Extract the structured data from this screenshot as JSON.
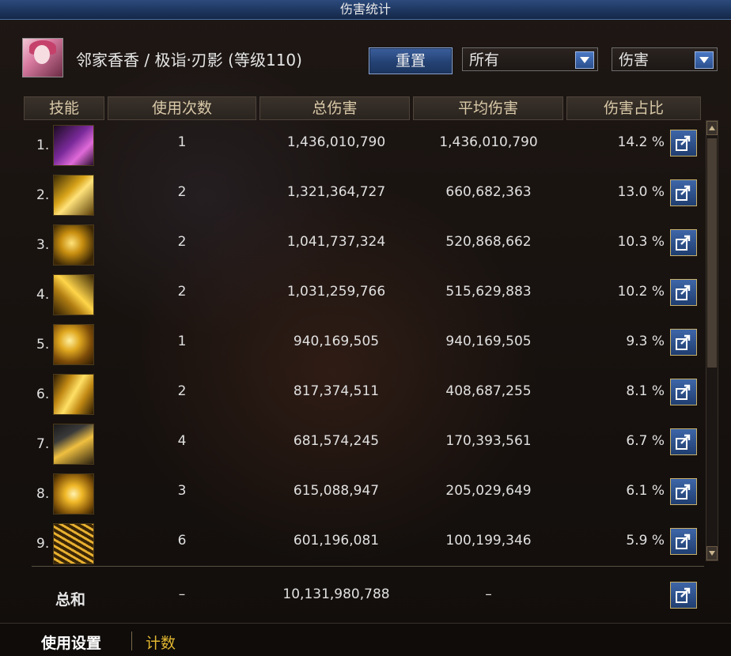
{
  "window": {
    "title": "伤害统计"
  },
  "character": {
    "name": "邻家香香 / 极诣·刃影 (等级110)"
  },
  "toolbar": {
    "reset_label": "重置",
    "filter_value": "所有",
    "metric_value": "伤害"
  },
  "table": {
    "headers": [
      "技能",
      "使用次数",
      "总伤害",
      "平均伤害",
      "伤害占比"
    ],
    "rows": [
      {
        "rank": "1.",
        "uses": "1",
        "total": "1,436,010,790",
        "avg": "1,436,010,790",
        "pct": "14.2 %"
      },
      {
        "rank": "2.",
        "uses": "2",
        "total": "1,321,364,727",
        "avg": "660,682,363",
        "pct": "13.0 %"
      },
      {
        "rank": "3.",
        "uses": "2",
        "total": "1,041,737,324",
        "avg": "520,868,662",
        "pct": "10.3 %"
      },
      {
        "rank": "4.",
        "uses": "2",
        "total": "1,031,259,766",
        "avg": "515,629,883",
        "pct": "10.2 %"
      },
      {
        "rank": "5.",
        "uses": "1",
        "total": "940,169,505",
        "avg": "940,169,505",
        "pct": "9.3 %"
      },
      {
        "rank": "6.",
        "uses": "2",
        "total": "817,374,511",
        "avg": "408,687,255",
        "pct": "8.1 %"
      },
      {
        "rank": "7.",
        "uses": "4",
        "total": "681,574,245",
        "avg": "170,393,561",
        "pct": "6.7 %"
      },
      {
        "rank": "8.",
        "uses": "3",
        "total": "615,088,947",
        "avg": "205,029,649",
        "pct": "6.1 %"
      },
      {
        "rank": "9.",
        "uses": "6",
        "total": "601,196,081",
        "avg": "100,199,346",
        "pct": "5.9 %"
      }
    ],
    "total": {
      "label": "总和",
      "uses": "–",
      "total": "10,131,980,788",
      "avg": "–"
    }
  },
  "footer": {
    "tab_settings": "使用设置",
    "tab_count": "计数"
  },
  "colors": {
    "accent_gold": "#e2b730",
    "button_blue": "#2b4f8c",
    "title_blue": "#1d355d"
  },
  "icons": [
    "skill-icon",
    "share-icon",
    "chevron-down-icon",
    "scroll-up-icon",
    "scroll-down-icon"
  ]
}
